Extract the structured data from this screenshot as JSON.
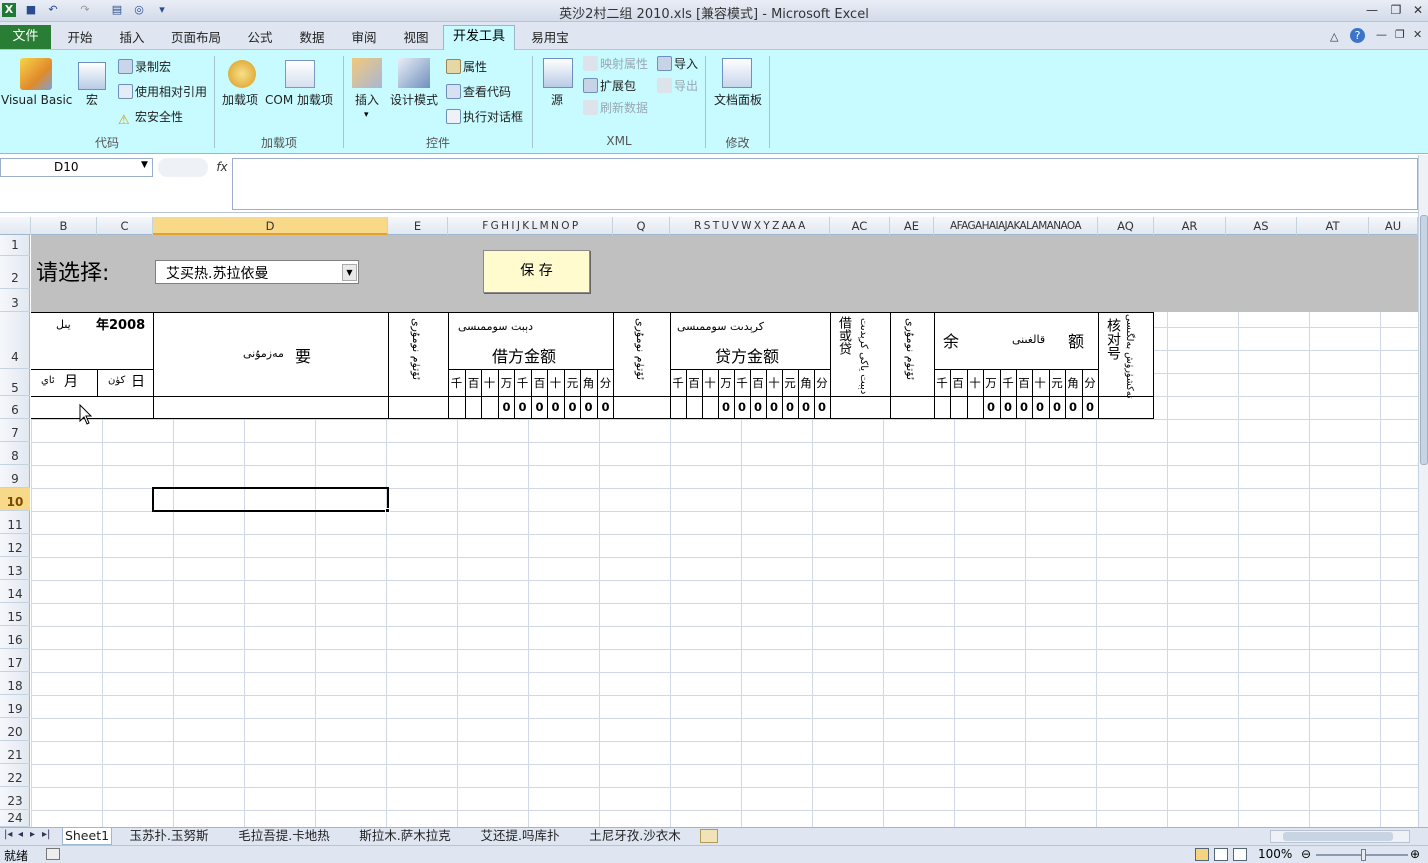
{
  "window": {
    "title": "英沙2村二组  2010.xls  [兼容模式] - Microsoft Excel"
  },
  "tabs": {
    "file": "文件",
    "home": "开始",
    "insert": "插入",
    "layout": "页面布局",
    "formulas": "公式",
    "data": "数据",
    "review": "审阅",
    "view": "视图",
    "developer": "开发工具",
    "yiyong": "易用宝"
  },
  "ribbon": {
    "code": {
      "label": "代码",
      "visual_basic": "Visual Basic",
      "macros": "宏",
      "record": "录制宏",
      "relative": "使用相对引用",
      "security": "宏安全性"
    },
    "addins": {
      "label": "加载项",
      "addins": "加载项",
      "com": "COM 加载项"
    },
    "controls": {
      "label": "控件",
      "insert": "插入",
      "design": "设计模式",
      "properties": "属性",
      "view_code": "查看代码",
      "run_dialog": "执行对话框"
    },
    "xml": {
      "label": "XML",
      "source": "源",
      "map_props": "映射属性",
      "expansion": "扩展包",
      "refresh": "刷新数据",
      "import": "导入",
      "export": "导出"
    },
    "modify": {
      "label": "修改",
      "doc_panel": "文档面板"
    }
  },
  "formula_bar": {
    "name_box": "D10",
    "fx": "fx",
    "formula": ""
  },
  "columns": [
    "B",
    "C",
    "D",
    "E",
    "F",
    "G",
    "H",
    "I",
    "J",
    "K",
    "L",
    "M",
    "N",
    "O",
    "P",
    "Q",
    "R",
    "S",
    "T",
    "U",
    "V",
    "W",
    "X",
    "Y",
    "Z",
    "AA",
    "AC",
    "AE",
    "AF",
    "AG",
    "AH",
    "AI",
    "AJ",
    "AK",
    "AL",
    "AM",
    "AN",
    "AO",
    "AQ",
    "AR",
    "AS",
    "AT",
    "AU"
  ],
  "column_headers_text": {
    "B": "B",
    "C": "C",
    "D": "D",
    "E": "E",
    "Q": "Q",
    "AC": "AC",
    "AE": "AE",
    "AQ": "AQ",
    "AR": "AR",
    "AS": "AS",
    "AT": "AT",
    "AU": "AU",
    "fgh": "F G H I J K L M N O P",
    "rstuv": "R S T U V W X Y Z AA A",
    "afag": "AFAGAHAIAJAKALAMANAOA"
  },
  "rows": [
    "1",
    "2",
    "3",
    "4",
    "5",
    "6",
    "7",
    "8",
    "9",
    "10",
    "11",
    "12",
    "13",
    "14",
    "15",
    "16",
    "17",
    "18",
    "19",
    "20",
    "21",
    "22",
    "23",
    "24"
  ],
  "sheet": {
    "prompt": "请选择:",
    "dropdown_value": "艾买热.苏拉依曼",
    "save_button": "保 存",
    "year_label": "年2008",
    "year_ug": "يىل",
    "month_label": "月",
    "month_ug": "ئاي",
    "day_label": "日",
    "day_ug": "كۈن",
    "summary_label": "要",
    "summary_ug": "مەزمۇنى",
    "voucher_ug": "ئۆتۈم نومۇرى",
    "debit_ug": "دېبت سوممىسى",
    "debit_label": "借方金额",
    "credit_ug": "كرېدىت سوممىسى",
    "credit_label": "贷方金额",
    "direction_label": "借或贷",
    "direction_ug": "دېبت ياكى كرېدىت",
    "balance_left": "余",
    "balance_ug": "قالغىنى",
    "balance_right": "额",
    "check_label": "核对号",
    "check_ug": "تەكشۈرۈش بەلگىسى",
    "units": [
      "千",
      "百",
      "十",
      "万",
      "千",
      "百",
      "十",
      "元",
      "角",
      "分"
    ],
    "debit_zeros": [
      "0",
      "0",
      "0",
      "0",
      "0",
      "0",
      "0"
    ],
    "credit_zeros": [
      "0",
      "0",
      "0",
      "0",
      "0",
      "0",
      "0"
    ],
    "balance_zeros": [
      "0",
      "0",
      "0",
      "0",
      "0",
      "0",
      "0"
    ]
  },
  "sheet_tabs": [
    "Sheet1",
    "玉苏扑.玉努斯",
    "毛拉吾提.卡地热",
    "斯拉木.萨木拉克",
    "艾还提.吗库扑",
    "土尼牙孜.沙衣木"
  ],
  "status": {
    "ready": "就绪",
    "zoom": "100%"
  }
}
